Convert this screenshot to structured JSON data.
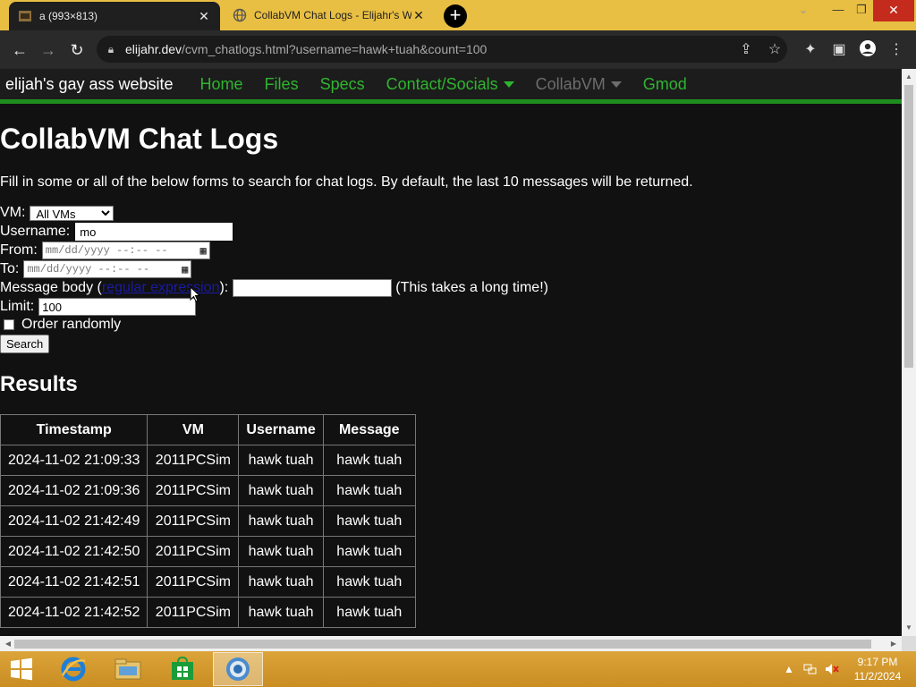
{
  "browser": {
    "tabs": [
      {
        "title": "a (993×813)",
        "active": false,
        "icon": "image-favicon-icon"
      },
      {
        "title": "CollabVM Chat Logs - Elijahr's W",
        "active": true,
        "icon": "globe-favicon-icon"
      }
    ],
    "url_host": "elijahr.dev",
    "url_path": "/cvm_chatlogs.html?username=hawk+tuah&count=100"
  },
  "site": {
    "brand": "elijah's gay ass website",
    "nav": [
      {
        "label": "Home"
      },
      {
        "label": "Files"
      },
      {
        "label": "Specs"
      },
      {
        "label": "Contact/Socials",
        "dropdown": true
      },
      {
        "label": "CollabVM",
        "dropdown": true,
        "current": true
      },
      {
        "label": "Gmod"
      }
    ]
  },
  "page": {
    "title": "CollabVM Chat Logs",
    "intro": "Fill in some or all of the below forms to search for chat logs. By default, the last 10 messages will be returned.",
    "form": {
      "vm_label": "VM:",
      "vm_value": "All VMs",
      "username_label": "Username:",
      "username_value": "mo",
      "from_label": "From:",
      "to_label": "To:",
      "datetime_placeholder": "mm/dd/yyyy --:-- --",
      "message_label_prefix": "Message body (",
      "message_link": "regular expression",
      "message_label_suffix": "):",
      "message_note": "(This takes a long time!)",
      "limit_label": "Limit:",
      "limit_value": "100",
      "random_label": "Order randomly",
      "search_label": "Search"
    },
    "results_title": "Results",
    "table": {
      "headers": [
        "Timestamp",
        "VM",
        "Username",
        "Message"
      ],
      "rows": [
        [
          "2024-11-02 21:09:33",
          "2011PCSim",
          "hawk tuah",
          "hawk tuah"
        ],
        [
          "2024-11-02 21:09:36",
          "2011PCSim",
          "hawk tuah",
          "hawk tuah"
        ],
        [
          "2024-11-02 21:42:49",
          "2011PCSim",
          "hawk tuah",
          "hawk tuah"
        ],
        [
          "2024-11-02 21:42:50",
          "2011PCSim",
          "hawk tuah",
          "hawk tuah"
        ],
        [
          "2024-11-02 21:42:51",
          "2011PCSim",
          "hawk tuah",
          "hawk tuah"
        ],
        [
          "2024-11-02 21:42:52",
          "2011PCSim",
          "hawk tuah",
          "hawk tuah"
        ]
      ]
    }
  },
  "taskbar": {
    "time": "9:17 PM",
    "date": "11/2/2024"
  },
  "colors": {
    "accent_green": "#2fb52f",
    "titlebar": "#e9bf43",
    "taskbar": "#d49a2a"
  }
}
